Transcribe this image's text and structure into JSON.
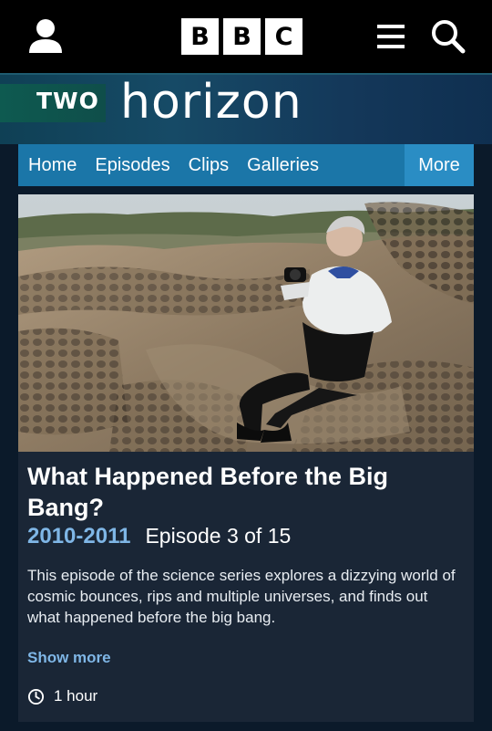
{
  "header": {
    "logo_letters": [
      "B",
      "B",
      "C"
    ],
    "icons": {
      "account": "user-icon",
      "menu": "hamburger-icon",
      "search": "search-icon"
    }
  },
  "brand": {
    "channel": "TWO",
    "programme": "horizon"
  },
  "nav": {
    "items": [
      "Home",
      "Episodes",
      "Clips",
      "Galleries"
    ],
    "more": "More"
  },
  "episode": {
    "title": "What Happened Before the Big Bang?",
    "series": "2010-2011",
    "number": "Episode 3 of 15",
    "description": "This episode of the science series explores a dizzying world of cosmic bounces, rips and multiple universes, and finds out what happened before the big bang.",
    "show_more": "Show more",
    "duration": "1 hour",
    "duration_icon": "clock-icon"
  },
  "colors": {
    "nav_bg": "#1b76a8",
    "nav_more_bg": "#2a8dc4",
    "accent_text": "#7fb6e6",
    "card_bg": "#1a2636"
  }
}
